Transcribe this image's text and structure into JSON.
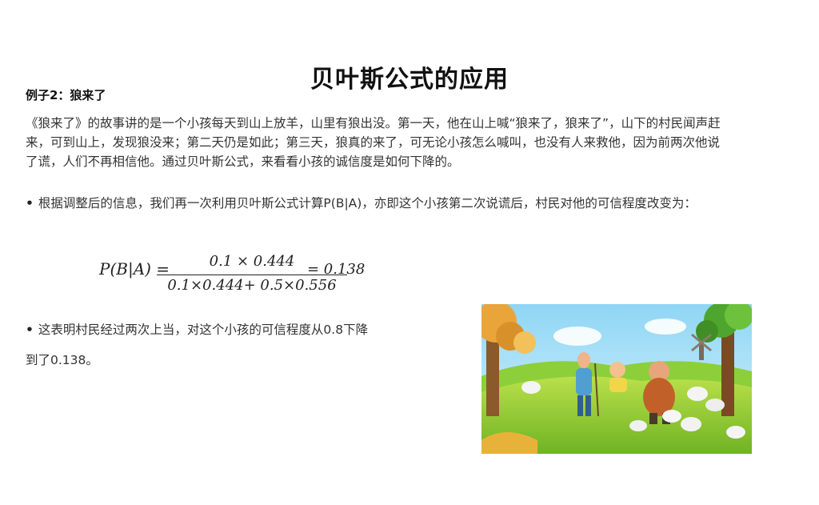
{
  "title": "贝叶斯公式的应用",
  "example_label": "例子2：狼来了",
  "story": "《狼来了》的故事讲的是一个小孩每天到山上放羊，山里有狼出没。第一天，他在山上喊“狼来了，狼来了”，山下的村民闻声赶来，可到山上，发现狼没来；第二天仍是如此；第三天，狼真的来了，可无论小孩怎么喊叫，也没有人来救他，因为前两次他说了谎，人们不再相信他。通过贝叶斯公式，来看看小孩的诚信度是如何下降的。",
  "bullet1": "根据调整后的信息，我们再一次利用贝叶斯公式计算P(B|A)，亦即这个小孩第二次说谎后，村民对他的可信程度改变为：",
  "formula": {
    "lhs": "P(B|A) =",
    "numerator": "0.1 × 0.444",
    "denominator": "0.1×0.444+ 0.5×0.556",
    "result": "= 0.138"
  },
  "bullet2": "这表明村民经过两次上当，对这个小孩的可信程度从0.8下降",
  "bullet2_cont": "到了0.138。"
}
